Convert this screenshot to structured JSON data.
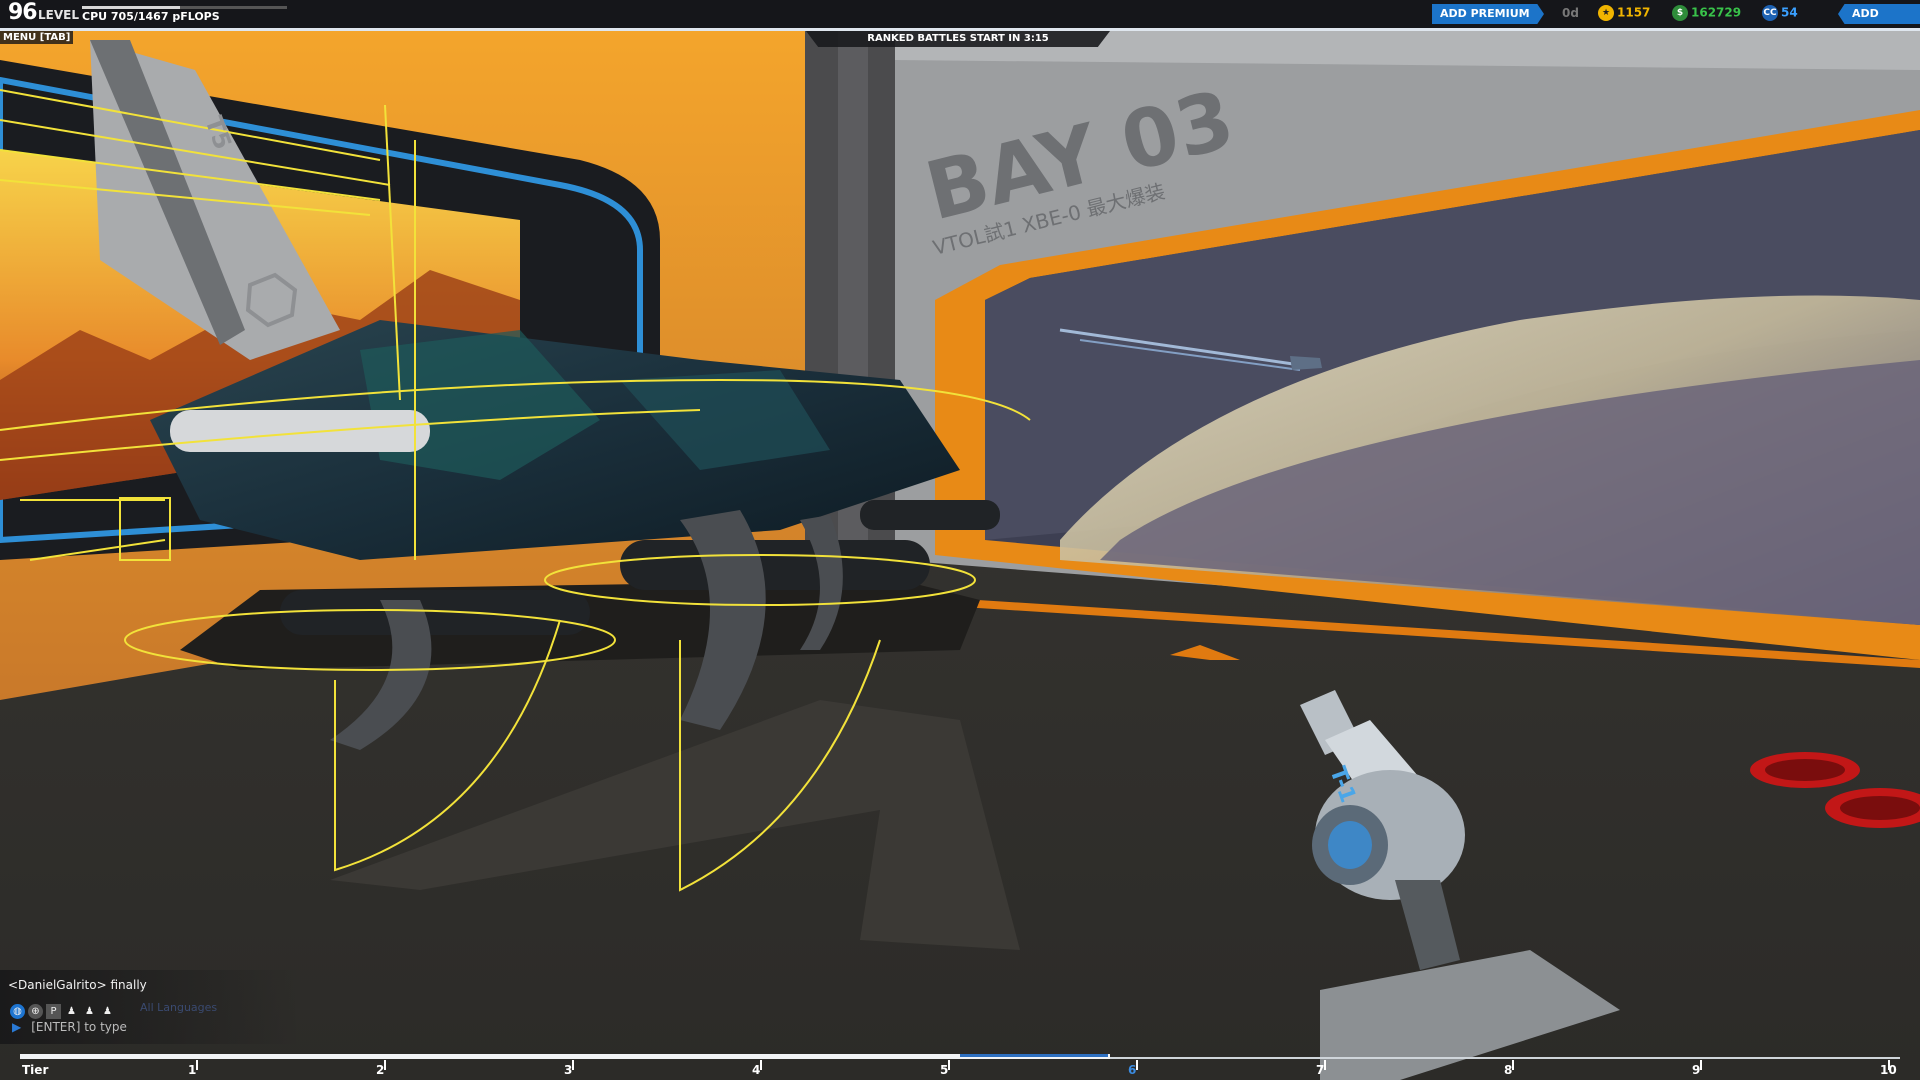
{
  "hud": {
    "level_number": "96",
    "level_label": "LEVEL",
    "cpu_text": "CPU 705/1467 pFLOPS",
    "cpu_fraction": 0.48,
    "menu_label": "MENU [TAB]",
    "ranked_text": "RANKED BATTLES START IN 3:15",
    "add_premium_label": "ADD PREMIUM",
    "premium_days": "0d",
    "currency_1": "1157",
    "currency_2": "162729",
    "currency_3": "54",
    "currency_3_icon_text": "CC",
    "add_funds_label": "ADD FUNDS",
    "colors": {
      "accent_blue": "#1c74c9",
      "money_green": "#39c24a",
      "cosmetic_blue": "#3aa0ff",
      "gold": "#f0b400"
    }
  },
  "scene": {
    "bay_title": "BAY 03",
    "bay_subtitle": "VTOL試1 XBE-0 最大爆装",
    "robot_plate": "T5",
    "tool_label": "T-1"
  },
  "chat": {
    "message": "<DanielGalrito> finally",
    "language_filter": "All Languages",
    "input_hint": "[ENTER] to type",
    "icons": [
      "globe-icon",
      "settings-globe-icon",
      "p-icon",
      "user-icon",
      "user-plus-icon",
      "users-icon"
    ]
  },
  "tier_bar": {
    "labels": [
      "Tier",
      "1",
      "2",
      "3",
      "4",
      "5",
      "6",
      "7",
      "8",
      "9",
      "10"
    ],
    "current_tier": "6",
    "progress": 0.58
  }
}
